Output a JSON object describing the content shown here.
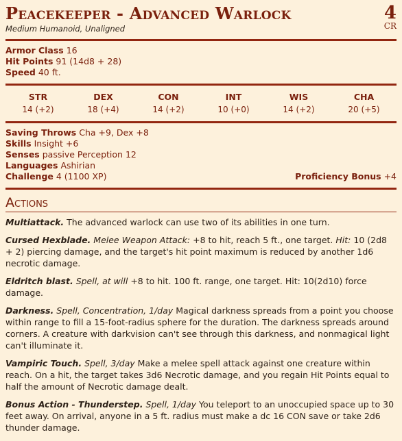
{
  "header": {
    "name": "Peacekeeper - Advanced Warlock",
    "meta": "Medium Humanoid, Unaligned",
    "cr_value": "4",
    "cr_label": "CR"
  },
  "basics": {
    "ac_label": "Armor Class",
    "ac_value": "16",
    "hp_label": "Hit Points",
    "hp_value": "91 (14d8 + 28)",
    "speed_label": "Speed",
    "speed_value": "40 ft."
  },
  "abilities": [
    {
      "name": "STR",
      "value": "14 (+2)"
    },
    {
      "name": "DEX",
      "value": "18 (+4)"
    },
    {
      "name": "CON",
      "value": "14 (+2)"
    },
    {
      "name": "INT",
      "value": "10 (+0)"
    },
    {
      "name": "WIS",
      "value": "14 (+2)"
    },
    {
      "name": "CHA",
      "value": "20 (+5)"
    }
  ],
  "details": {
    "saves_label": "Saving Throws",
    "saves_value": "Cha +9, Dex +8",
    "skills_label": "Skills",
    "skills_value": "Insight +6",
    "senses_label": "Senses",
    "senses_value": "passive Perception 12",
    "languages_label": "Languages",
    "languages_value": "Ashirian",
    "challenge_label": "Challenge",
    "challenge_value": "4 (1100 XP)",
    "prof_label": "Proficiency Bonus",
    "prof_value": "+4"
  },
  "actions_title": "Actions",
  "actions": [
    {
      "name": "Multiattack.",
      "type": "",
      "text": "The advanced warlock can use two of its abilities in one turn."
    },
    {
      "name": "Cursed Hexblade.",
      "type": "Melee Weapon Attack:",
      "text": "+8 to hit, reach 5 ft., one target.",
      "hit_label": "Hit:",
      "hit_text": "10 (2d8 + 2) piercing damage, and the target's hit point maximum is reduced by another 1d6 necrotic damage."
    },
    {
      "name": "Eldritch blast.",
      "type": "Spell, at will",
      "text": "+8 to hit. 100 ft. range, one target. Hit: 10(2d10) force damage."
    },
    {
      "name": "Darkness.",
      "type": "Spell, Concentration, 1/day",
      "text": "Magical darkness spreads from a point you choose within range to fill a 15-foot-radius sphere for the duration. The darkness spreads around corners. A creature with darkvision can't see through this darkness, and nonmagical light can't illuminate it."
    },
    {
      "name": "Vampiric Touch.",
      "type": "Spell, 3/day",
      "text": "Make a melee spell attack against one creature within reach. On a hit, the target takes 3d6 Necrotic damage, and you regain Hit Points equal to half the amount of Necrotic damage dealt."
    },
    {
      "name": "Bonus Action - Thunderstep.",
      "type": "Spell, 1/day",
      "text": "You teleport to an unoccupied space up to 30 feet away. On arrival, anyone in a 5 ft. radius must make a dc 16 CON save or take 2d6 thunder damage."
    }
  ]
}
